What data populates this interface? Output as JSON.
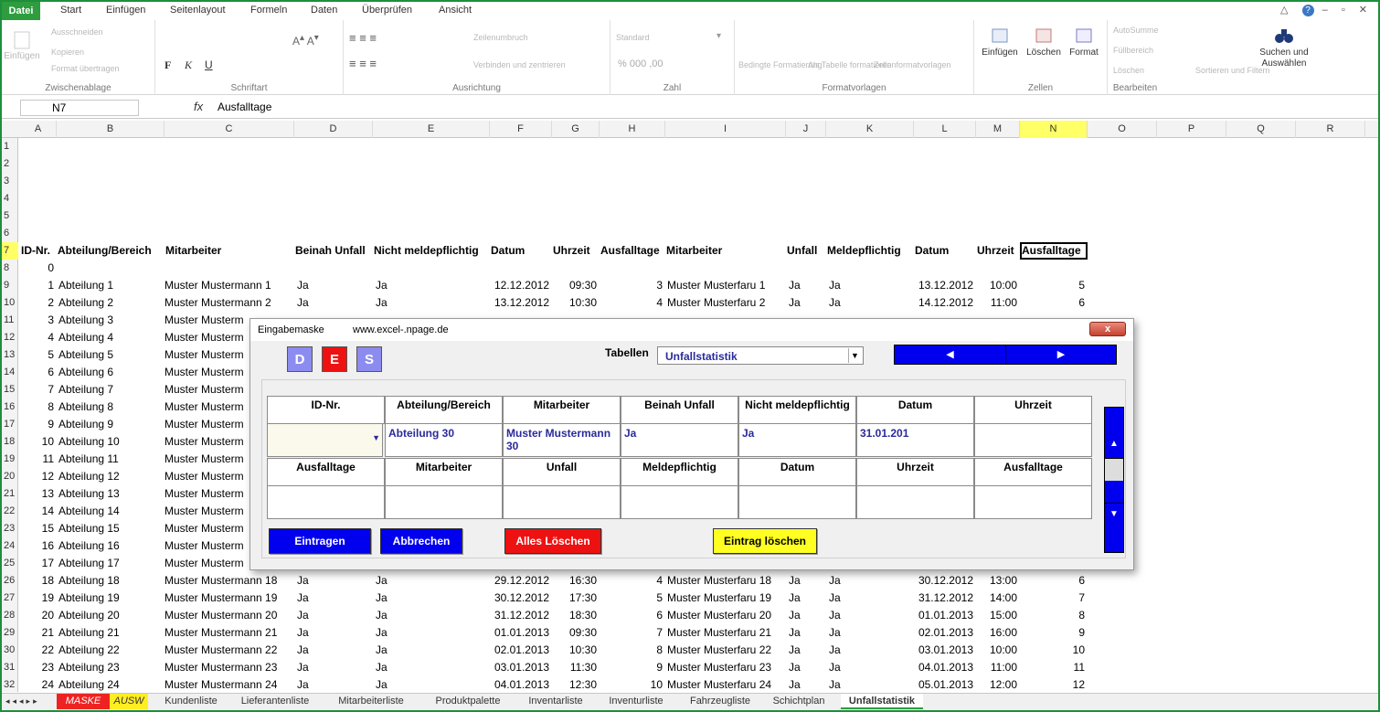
{
  "ribbon": {
    "file_tab": "Datei",
    "tabs": [
      "Start",
      "Einfügen",
      "Seitenlayout",
      "Formeln",
      "Daten",
      "Überprüfen",
      "Ansicht"
    ],
    "groups": {
      "clipboard": "Zwischenablage",
      "font": "Schriftart",
      "alignment": "Ausrichtung",
      "number": "Zahl",
      "styles": "Formatvorlagen",
      "cells": "Zellen",
      "editing": "Bearbeiten"
    },
    "clipboard_items": [
      "Ausschneiden",
      "Kopieren",
      "Format übertragen"
    ],
    "paste_label": "Einfügen",
    "alignment_items": [
      "Zeilenumbruch",
      "Verbinden und zentrieren"
    ],
    "number_format": "Standard",
    "style_items": [
      "Bedingte Formatierung",
      "Als Tabelle formatieren",
      "Zellenformatvorlagen"
    ],
    "cells_buttons": [
      "Einfügen",
      "Löschen",
      "Format"
    ],
    "editing_items": [
      "AutoSumme",
      "Füllbereich",
      "Löschen"
    ],
    "sort_filter": "Sortieren und Filtern",
    "find_select": "Suchen und Auswählen"
  },
  "formula_bar": {
    "name_box": "N7",
    "fx": "fx",
    "value": "Ausfalltage"
  },
  "columns": [
    "A",
    "B",
    "C",
    "D",
    "E",
    "F",
    "G",
    "H",
    "I",
    "J",
    "K",
    "L",
    "M",
    "N",
    "O",
    "P",
    "Q",
    "R"
  ],
  "headers": {
    "A": "ID-Nr.",
    "B": "Abteilung/Bereich",
    "C": "Mitarbeiter",
    "D": "Beinah Unfall",
    "E": "Nicht meldepflichtig",
    "F": "Datum",
    "G": "Uhrzeit",
    "H": "Ausfalltage",
    "I": "Mitarbeiter",
    "J": "Unfall",
    "K": "Meldepflichtig",
    "L": "Datum",
    "M": "Uhrzeit",
    "N": "Ausfalltage"
  },
  "row8_id": "0",
  "rows_top": [
    {
      "row": "9",
      "id": "1",
      "abt": "Abteilung 1",
      "ma": "Muster Mustermann 1",
      "bu": "Ja",
      "nm": "Ja",
      "datum": "12.12.2012",
      "zeit": "09:30",
      "h": "3",
      "ma2": "Muster Musterfaru 1",
      "u": "Ja",
      "m": "Ja",
      "datum2": "13.12.2012",
      "zeit2": "10:00",
      "n": "5"
    },
    {
      "row": "10",
      "id": "2",
      "abt": "Abteilung 2",
      "ma": "Muster Mustermann 2",
      "bu": "Ja",
      "nm": "Ja",
      "datum": "13.12.2012",
      "zeit": "10:30",
      "h": "4",
      "ma2": "Muster Musterfaru 2",
      "u": "Ja",
      "m": "Ja",
      "datum2": "14.12.2012",
      "zeit2": "11:00",
      "n": "6"
    },
    {
      "row": "11",
      "id": "3",
      "abt": "Abteilung 3",
      "ma": "Muster Musterm"
    }
  ],
  "rows_mid": [
    {
      "row": "12",
      "id": "4",
      "abt": "Abteilung 4",
      "ma": "Muster Musterm"
    },
    {
      "row": "13",
      "id": "5",
      "abt": "Abteilung 5",
      "ma": "Muster Musterm"
    },
    {
      "row": "14",
      "id": "6",
      "abt": "Abteilung 6",
      "ma": "Muster Musterm"
    },
    {
      "row": "15",
      "id": "7",
      "abt": "Abteilung 7",
      "ma": "Muster Musterm"
    },
    {
      "row": "16",
      "id": "8",
      "abt": "Abteilung 8",
      "ma": "Muster Musterm"
    },
    {
      "row": "17",
      "id": "9",
      "abt": "Abteilung 9",
      "ma": "Muster Musterm"
    },
    {
      "row": "18",
      "id": "10",
      "abt": "Abteilung 10",
      "ma": "Muster Musterm"
    },
    {
      "row": "19",
      "id": "11",
      "abt": "Abteilung 11",
      "ma": "Muster Musterm"
    },
    {
      "row": "20",
      "id": "12",
      "abt": "Abteilung 12",
      "ma": "Muster Musterm"
    },
    {
      "row": "21",
      "id": "13",
      "abt": "Abteilung 13",
      "ma": "Muster Musterm"
    },
    {
      "row": "22",
      "id": "14",
      "abt": "Abteilung 14",
      "ma": "Muster Musterm"
    },
    {
      "row": "23",
      "id": "15",
      "abt": "Abteilung 15",
      "ma": "Muster Musterm"
    },
    {
      "row": "24",
      "id": "16",
      "abt": "Abteilung 16",
      "ma": "Muster Musterm"
    },
    {
      "row": "25",
      "id": "17",
      "abt": "Abteilung 17",
      "ma": "Muster Musterm"
    }
  ],
  "rows_bottom": [
    {
      "row": "26",
      "id": "18",
      "abt": "Abteilung 18",
      "ma": "Muster Mustermann 18",
      "bu": "Ja",
      "nm": "Ja",
      "datum": "29.12.2012",
      "zeit": "16:30",
      "h": "4",
      "ma2": "Muster Musterfaru 18",
      "u": "Ja",
      "m": "Ja",
      "datum2": "30.12.2012",
      "zeit2": "13:00",
      "n": "6"
    },
    {
      "row": "27",
      "id": "19",
      "abt": "Abteilung 19",
      "ma": "Muster Mustermann 19",
      "bu": "Ja",
      "nm": "Ja",
      "datum": "30.12.2012",
      "zeit": "17:30",
      "h": "5",
      "ma2": "Muster Musterfaru 19",
      "u": "Ja",
      "m": "Ja",
      "datum2": "31.12.2012",
      "zeit2": "14:00",
      "n": "7"
    },
    {
      "row": "28",
      "id": "20",
      "abt": "Abteilung 20",
      "ma": "Muster Mustermann 20",
      "bu": "Ja",
      "nm": "Ja",
      "datum": "31.12.2012",
      "zeit": "18:30",
      "h": "6",
      "ma2": "Muster Musterfaru 20",
      "u": "Ja",
      "m": "Ja",
      "datum2": "01.01.2013",
      "zeit2": "15:00",
      "n": "8"
    },
    {
      "row": "29",
      "id": "21",
      "abt": "Abteilung 21",
      "ma": "Muster Mustermann 21",
      "bu": "Ja",
      "nm": "Ja",
      "datum": "01.01.2013",
      "zeit": "09:30",
      "h": "7",
      "ma2": "Muster Musterfaru 21",
      "u": "Ja",
      "m": "Ja",
      "datum2": "02.01.2013",
      "zeit2": "16:00",
      "n": "9"
    },
    {
      "row": "30",
      "id": "22",
      "abt": "Abteilung 22",
      "ma": "Muster Mustermann 22",
      "bu": "Ja",
      "nm": "Ja",
      "datum": "02.01.2013",
      "zeit": "10:30",
      "h": "8",
      "ma2": "Muster Musterfaru 22",
      "u": "Ja",
      "m": "Ja",
      "datum2": "03.01.2013",
      "zeit2": "10:00",
      "n": "10"
    },
    {
      "row": "31",
      "id": "23",
      "abt": "Abteilung 23",
      "ma": "Muster Mustermann 23",
      "bu": "Ja",
      "nm": "Ja",
      "datum": "03.01.2013",
      "zeit": "11:30",
      "h": "9",
      "ma2": "Muster Musterfaru 23",
      "u": "Ja",
      "m": "Ja",
      "datum2": "04.01.2013",
      "zeit2": "11:00",
      "n": "11"
    },
    {
      "row": "32",
      "id": "24",
      "abt": "Abteilung 24",
      "ma": "Muster Mustermann 24",
      "bu": "Ja",
      "nm": "Ja",
      "datum": "04.01.2013",
      "zeit": "12:30",
      "h": "10",
      "ma2": "Muster Musterfaru 24",
      "u": "Ja",
      "m": "Ja",
      "datum2": "05.01.2013",
      "zeit2": "12:00",
      "n": "12"
    }
  ],
  "sheet_tabs": [
    "MASKE",
    "AUSW",
    "Kundenliste",
    "Lieferantenliste",
    "Mitarbeiterliste",
    "Produktpalette",
    "Inventarliste",
    "Inventurliste",
    "Fahrzeugliste",
    "Schichtplan",
    "Unfallstatistik"
  ],
  "dialog": {
    "title": "Eingabemaske",
    "url": "www.excel-.npage.de",
    "close": "x",
    "lang_buttons": [
      "D",
      "E",
      "S"
    ],
    "tables_label": "Tabellen",
    "tables_value": "Unfallstatistik",
    "nav_prev": "◀",
    "nav_next": "▶",
    "grid_header1": [
      "ID-Nr.",
      "Abteilung/Bereich",
      "Mitarbeiter",
      "Beinah Unfall",
      "Nicht meldepflichtig",
      "Datum",
      "Uhrzeit"
    ],
    "grid_values1": [
      "",
      "Abteilung 30",
      "Muster Mustermann 30",
      "Ja",
      "Ja",
      "31.01.201",
      ""
    ],
    "grid_header2": [
      "Ausfalltage",
      "Mitarbeiter",
      "Unfall",
      "Meldepflichtig",
      "Datum",
      "Uhrzeit",
      "Ausfalltage"
    ],
    "btn_enter": "Eintragen",
    "btn_cancel": "Abbrechen",
    "btn_clear_all": "Alles Löschen",
    "btn_delete_entry": "Eintrag löschen",
    "scroll_up": "▲",
    "scroll_down": "▼"
  },
  "colors": {
    "accent": "#2e9c3f",
    "dialog_blue": "#0000ee",
    "red": "#ee0000",
    "yellow": "#ffff22",
    "selected_col": "#ffff66"
  }
}
